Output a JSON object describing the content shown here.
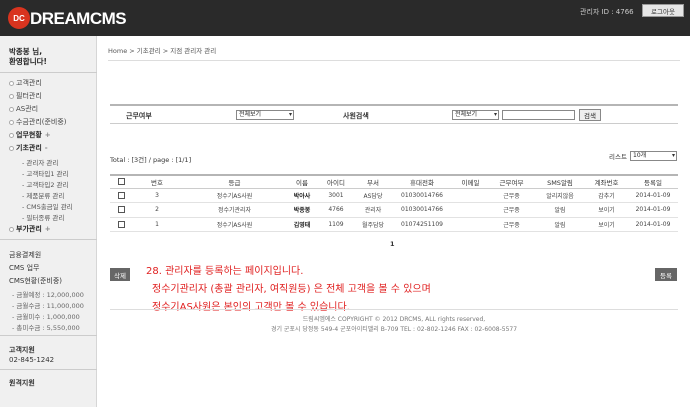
{
  "header": {
    "logo_mark": "DC",
    "logo_text": "DREAMCMS",
    "admin_id": "관리자 ID : 4766",
    "logout_label": "로그아웃"
  },
  "sidebar": {
    "welcome_line1": "박종봉 님,",
    "welcome_line2": "환영합니다!",
    "menu": {
      "customer": "고객관리",
      "filter": "필터관리",
      "as": "AS관리",
      "collection": "수금관리(준비중)",
      "status": "업무현황",
      "basic": "기초관리",
      "extra": "부가관리"
    },
    "basic_subs": [
      "관리자 관리",
      "고객타입1 관리",
      "고객타입2 관리",
      "제품분류 관리",
      "CMS출금일 관리",
      "필터종류 관리"
    ],
    "finance_title": "금융결제원",
    "cms_work": "CMS 업무",
    "cms_status": "CMS현황(준비중)",
    "stats": [
      "금월예정 : 12,000,000",
      "금월수금 : 11,000,000",
      "금월미수 : 1,000,000",
      "총미수금 : 5,550,000"
    ],
    "support_title": "고객지원",
    "support_phone": "02-845-1242",
    "remote_title": "원격지원"
  },
  "breadcrumb": "Home > 기초관리 > 지점 관리자 관리",
  "filters": {
    "work_label": "근무여부",
    "work_value": "전체보기",
    "staff_label": "사원검색",
    "staff_value": "전체보기",
    "search_value": "",
    "search_btn": "검색"
  },
  "list": {
    "total": "Total : [3건] / page : [1/1]",
    "size_label": "리스트",
    "size_value": "10개"
  },
  "table": {
    "headers": [
      "번호",
      "등급",
      "이름",
      "아이디",
      "부서",
      "휴대전화",
      "이메일",
      "근무여부",
      "SMS알림",
      "계좌번호",
      "등록일"
    ],
    "rows": [
      [
        "3",
        "정수기AS사원",
        "박아사",
        "3001",
        "AS담당",
        "01030014766",
        "",
        "근무중",
        "알리지않음",
        "감추기",
        "2014-01-09"
      ],
      [
        "2",
        "정수기관리자",
        "박종봉",
        "4766",
        "관리자",
        "01030014766",
        "",
        "근무중",
        "알림",
        "보이기",
        "2014-01-09"
      ],
      [
        "1",
        "정수기AS사원",
        "김영태",
        "1109",
        "월주담당",
        "01074251109",
        "",
        "근무중",
        "알림",
        "보이기",
        "2014-01-09"
      ]
    ]
  },
  "pager": "1",
  "actions": {
    "delete_label": "삭제",
    "register_label": "등록"
  },
  "annotation": {
    "line1": "28. 관리자를 등록하는 페이지입니다.",
    "line2": "정수기관리자 (총괄 관리자, 여직원등) 은 전체 고객을 볼 수 있으며",
    "line3": "정수기AS사원은 본인의 고객만 볼 수 있습니다."
  },
  "footer": {
    "copyright": "드림씨엠에스 COPYRIGHT © 2012 DRCMS, ALL rights reserved,",
    "address": "경기 군포시 당정동 549-4 군포아이티밸리 B-709   TEL : 02-802-1246  FAX : 02-6008-5577"
  },
  "colors": {
    "header_bg": "#2a2a2a",
    "logo_accent": "#d9341f",
    "annotation": "#e02020"
  }
}
